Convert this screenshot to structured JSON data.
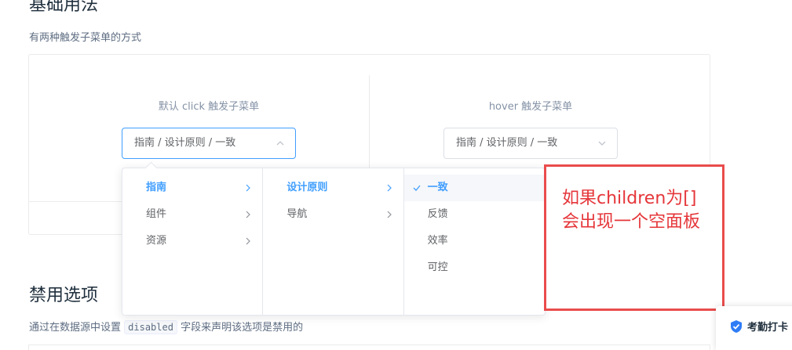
{
  "basic": {
    "title": "基础用法",
    "description": "有两种触发子菜单的方式",
    "click_demo": {
      "label": "默认 click 触发子菜单",
      "value": "指南 / 设计原则 / 一致"
    },
    "hover_demo": {
      "label": "hover 触发子菜单",
      "value": "指南 / 设计原则 / 一致"
    }
  },
  "dropdown": {
    "menu1": [
      "指南",
      "组件",
      "资源"
    ],
    "menu2": [
      "设计原则",
      "导航"
    ],
    "menu3": [
      "一致",
      "反馈",
      "效率",
      "可控"
    ]
  },
  "annotation": {
    "text": "如果children为[]\n会出现一个空面板",
    "color": "#e5363a"
  },
  "disabled": {
    "title": "禁用选项",
    "desc_prefix": "通过在数据源中设置 ",
    "desc_code": "disabled",
    "desc_suffix": " 字段来声明该选项是禁用的"
  },
  "checkin": {
    "label": "考勤打卡"
  },
  "colors": {
    "primary": "#409eff",
    "annotation_border": "#ea4c4c"
  }
}
